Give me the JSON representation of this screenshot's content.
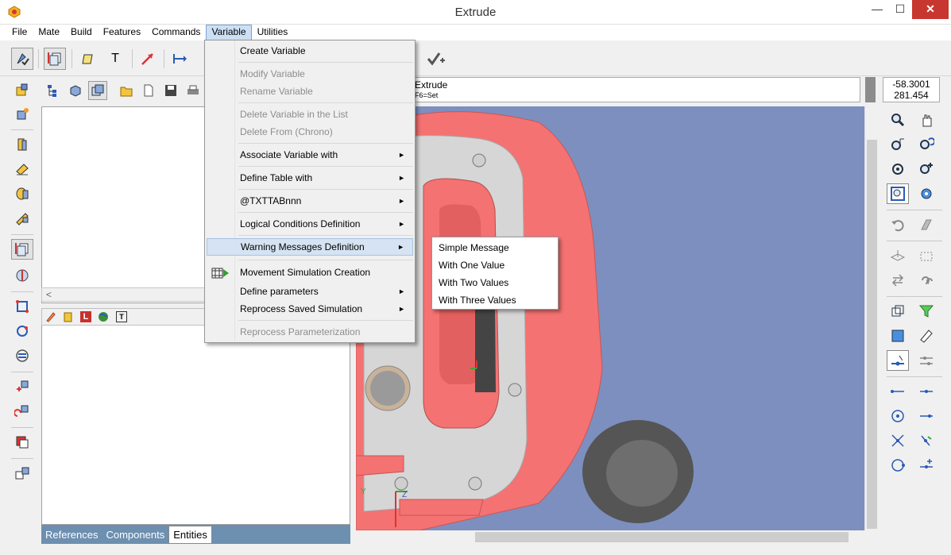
{
  "window": {
    "title": "Extrude",
    "minimize_glyph": "—",
    "maximize_glyph": "☐",
    "close_glyph": "✕"
  },
  "menubar": {
    "items": [
      {
        "label": "File"
      },
      {
        "label": "Mate"
      },
      {
        "label": "Build"
      },
      {
        "label": "Features"
      },
      {
        "label": "Commands"
      },
      {
        "label": "Variable"
      },
      {
        "label": "Utilities"
      }
    ],
    "active": "Variable"
  },
  "variable_menu": {
    "items": [
      {
        "label": "Create Variable",
        "enabled": true
      },
      {
        "label": "Modify Variable",
        "enabled": false
      },
      {
        "label": "Rename Variable",
        "enabled": false
      },
      {
        "label": "Delete Variable in the List",
        "enabled": false
      },
      {
        "label": "Delete From (Chrono)",
        "enabled": false
      },
      {
        "label": "Associate Variable with",
        "enabled": true,
        "submenu": true
      },
      {
        "label": "Define Table with",
        "enabled": true,
        "submenu": true
      },
      {
        "label": "@TXTTABnnn",
        "enabled": true,
        "submenu": true
      },
      {
        "label": "Logical Conditions Definition",
        "enabled": true,
        "submenu": true
      },
      {
        "label": "Warning Messages Definition",
        "enabled": true,
        "submenu": true,
        "highlighted": true
      },
      {
        "label": "Movement Simulation Creation",
        "enabled": true
      },
      {
        "label": "Define parameters",
        "enabled": true,
        "submenu": true
      },
      {
        "label": "Reprocess Saved Simulation",
        "enabled": true,
        "submenu": true
      },
      {
        "label": "Reprocess Parameterization",
        "enabled": false
      }
    ],
    "submenu_arrow": "►"
  },
  "warning_submenu": {
    "items": [
      "Simple Message",
      "With One Value",
      "With Two Values",
      "With Three Values"
    ]
  },
  "prompt": {
    "command": "Extrude",
    "hint": "F6=Set"
  },
  "coords": {
    "x": "-58.3001",
    "y": "281.454"
  },
  "bottom_tabs": [
    "References",
    "Components",
    "Entities"
  ],
  "active_tab": "Entities",
  "tree_scroll_arrow": "<",
  "axis": {
    "y": "Y",
    "z": "Z"
  },
  "colors": {
    "viewport_bg": "#7d8fbf",
    "part_red": "#f47272",
    "part_gray": "#d8d8d8",
    "tab_strip": "#6d8fb0",
    "menu_highlight": "#d5e3f2"
  },
  "icons": {
    "toolbar_text_tool": "T",
    "tree_tool_l": "L",
    "tree_tool_t": "T"
  }
}
